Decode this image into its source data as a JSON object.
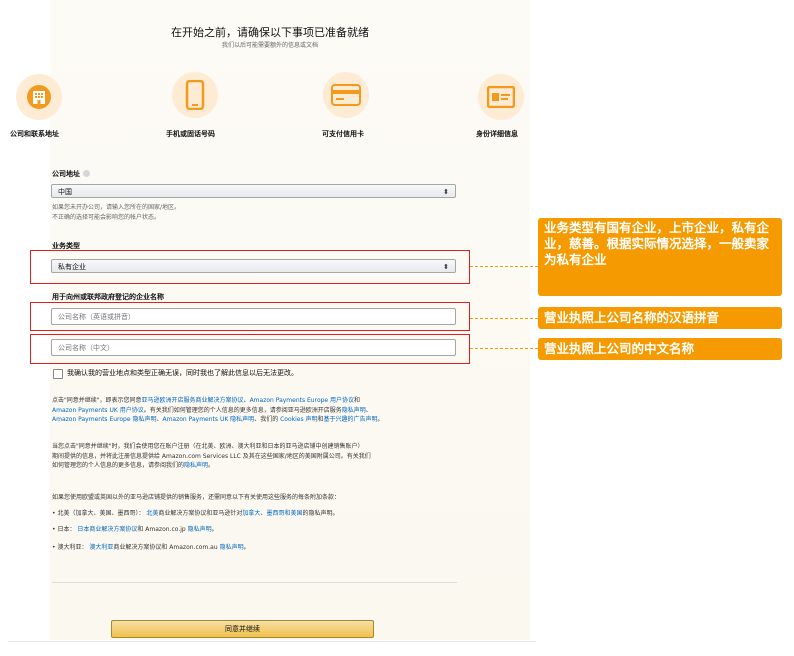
{
  "header": {
    "title": "在开始之前，请确保以下事项已准备就绪",
    "subtitle": "我们以后可能需要额外的信息或文档"
  },
  "requirements": [
    {
      "label": "公司和联系地址",
      "icon": "building-icon"
    },
    {
      "label": "手机或固话号码",
      "icon": "phone-icon"
    },
    {
      "label": "可支付信用卡",
      "icon": "credit-card-icon"
    },
    {
      "label": "身份详细信息",
      "icon": "id-card-icon"
    }
  ],
  "form": {
    "address_label": "公司地址",
    "country_value": "中国",
    "country_hint_1": "如果您未开办公司，请输入您所在的国家/地区。",
    "country_hint_2": "不正确的选择可能会影响您的帐户状态。",
    "business_type_label": "业务类型",
    "business_type_value": "私有企业",
    "name_label": "用于向州或联邦政府登记的企业名称",
    "name_pinyin_placeholder": "公司名称（英语或拼音）",
    "name_chinese_placeholder": "公司名称（中文）",
    "confirm_text": "我确认我的营业地点和类型正确无误，同时我也了解此信息以后无法更改。"
  },
  "legal": {
    "p1": [
      [
        {
          "t": "点击\"同意并继续\"，即表示您同意"
        },
        {
          "t": "亚马逊欧洲开店服务商业解决方案协议",
          "link": true
        },
        {
          "t": "、"
        },
        {
          "t": "Amazon Payments Europe 用户协议",
          "link": true
        },
        {
          "t": "和"
        }
      ],
      [
        {
          "t": "Amazon Payments UK 用户协议",
          "link": true
        },
        {
          "t": "。有关我们如何管理您的个人信息的更多信息，请参阅亚马逊欧洲开店服务"
        },
        {
          "t": "隐私声明",
          "link": true
        },
        {
          "t": "、"
        }
      ],
      [
        {
          "t": "Amazon Payments Europe 隐私声明",
          "link": true
        },
        {
          "t": "、"
        },
        {
          "t": "Amazon Payments UK 隐私声明",
          "link": true
        },
        {
          "t": "、我们的 "
        },
        {
          "t": "Cookies 声明",
          "link": true
        },
        {
          "t": "和"
        },
        {
          "t": "基于兴趣的广告声明",
          "link": true
        },
        {
          "t": "。"
        }
      ]
    ],
    "p2": [
      [
        {
          "t": "当您点击\"同意并继续\"时，我们会使用您在账户注册（在北美、欧洲、澳大利亚和日本的亚马逊店铺中创建销售账户）"
        }
      ],
      [
        {
          "t": "期间提供的信息，并将此注册信息提供给 Amazon.com Services LLC 及其在这些国家/地区的美国附属公司。有关我们"
        }
      ],
      [
        {
          "t": "如何管理您的个人信息的更多信息，请参阅我们的"
        },
        {
          "t": "隐私声明",
          "link": true
        },
        {
          "t": "。"
        }
      ]
    ],
    "p3": [
      [
        {
          "t": "如果您使用欧盟或英国以外的亚马逊店铺提供的销售服务，还需同意以下有关使用这些服务的每条附加条款："
        }
      ]
    ],
    "bullets": [
      [
        {
          "t": "北美（加拿大、美国、墨西哥）：  "
        },
        {
          "t": "北美",
          "link": true
        },
        {
          "t": "商业解决方案协议和亚马逊针对"
        },
        {
          "t": "加拿大",
          "link": true
        },
        {
          "t": "、"
        },
        {
          "t": "墨西哥和美国",
          "link": true
        },
        {
          "t": "的隐私声明。"
        }
      ],
      [
        {
          "t": "日本：  "
        },
        {
          "t": "日本商业解决方案协议",
          "link": true
        },
        {
          "t": "和 Amazon.co.jp "
        },
        {
          "t": "隐私声明",
          "link": true
        },
        {
          "t": "。"
        }
      ],
      [
        {
          "t": "澳大利亚：  "
        },
        {
          "t": "澳大利亚",
          "link": true
        },
        {
          "t": "商业解决方案协议和 Amazon.com.au "
        },
        {
          "t": "隐私声明",
          "link": true
        },
        {
          "t": "。"
        }
      ]
    ]
  },
  "button_label": "同意并继续",
  "annotations": {
    "business_type_note": "业务类型有国有企业，上市企业，私有企业，慈善。根据实际情况选择，一般卖家为私有企业",
    "pinyin_note": "营业执照上公司名称的汉语拼音",
    "chinese_note": "营业执照上公司的中文名称"
  },
  "colors": {
    "accent_orange": "#f59a00",
    "highlight_red": "#e02020",
    "link_blue": "#0066c0",
    "icon_circle": "#fdebd3"
  }
}
